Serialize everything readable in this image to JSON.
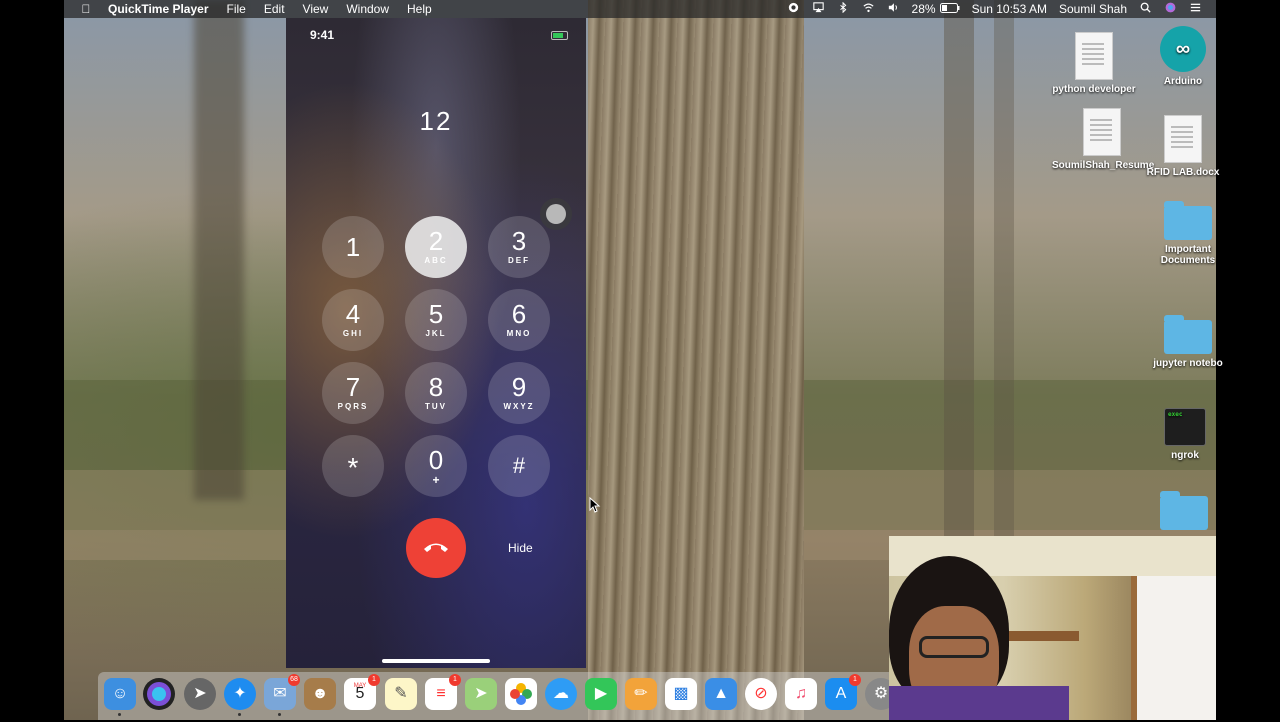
{
  "menubar": {
    "app_name": "QuickTime Player",
    "menus": [
      "File",
      "Edit",
      "View",
      "Window",
      "Help"
    ],
    "battery": "28%",
    "datetime": "Sun 10:53 AM",
    "user": "Soumil Shah"
  },
  "phone": {
    "status_time": "9:41",
    "dialed_number": "12",
    "keys": [
      {
        "digit": "1",
        "letters": ""
      },
      {
        "digit": "2",
        "letters": "ABC"
      },
      {
        "digit": "3",
        "letters": "DEF"
      },
      {
        "digit": "4",
        "letters": "GHI"
      },
      {
        "digit": "5",
        "letters": "JKL"
      },
      {
        "digit": "6",
        "letters": "MNO"
      },
      {
        "digit": "7",
        "letters": "PQRS"
      },
      {
        "digit": "8",
        "letters": "TUV"
      },
      {
        "digit": "9",
        "letters": "WXYZ"
      },
      {
        "digit": "*",
        "letters": ""
      },
      {
        "digit": "0",
        "letters": "+"
      },
      {
        "digit": "#",
        "letters": ""
      }
    ],
    "pressed_key": "2",
    "hide_label": "Hide",
    "end_call_color": "#ee4136"
  },
  "desktop_icons": [
    {
      "label": "python developer"
    },
    {
      "label": "Arduino"
    },
    {
      "label": "SoumilShah_Resume"
    },
    {
      "label": "RFID LAB.docx"
    },
    {
      "label": "Important Documents"
    },
    {
      "label": "jupyter notebo"
    },
    {
      "label": "ngrok"
    }
  ],
  "dock": {
    "calendar_month": "MAY",
    "calendar_day": "5",
    "badges": {
      "mail": "68",
      "calendar": "1",
      "reminders": "1",
      "appstore": "1"
    }
  }
}
